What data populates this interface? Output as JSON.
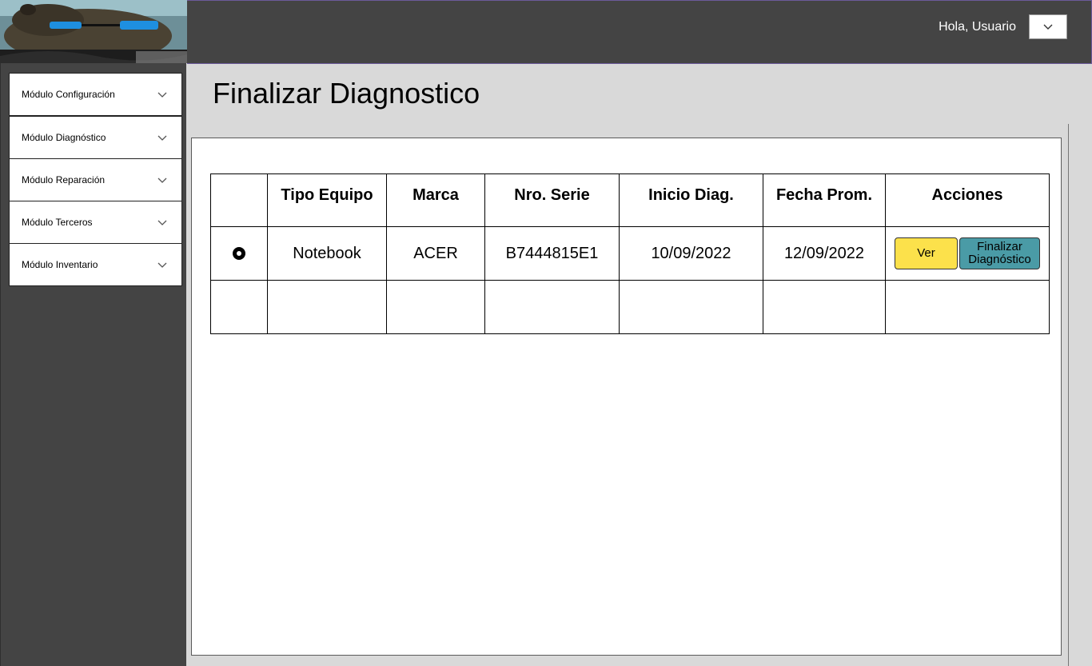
{
  "header": {
    "greeting": "Hola, Usuario",
    "dropdown_icon": "chevron-down-icon"
  },
  "sidebar": {
    "items": [
      {
        "label": "Módulo Configuración"
      },
      {
        "label": "Módulo Diagnóstico"
      },
      {
        "label": "Módulo Reparación"
      },
      {
        "label": "Módulo Terceros"
      },
      {
        "label": "Módulo Inventario"
      }
    ]
  },
  "page": {
    "title": "Finalizar Diagnostico"
  },
  "table": {
    "columns": [
      "",
      "Tipo Equipo",
      "Marca",
      "Nro. Serie",
      "Inicio Diag.",
      "Fecha Prom.",
      "Acciones"
    ],
    "rows": [
      {
        "tipo": "Notebook",
        "marca": "ACER",
        "serie": "B7444815E1",
        "inicio": "10/09/2022",
        "fecha": "12/09/2022",
        "ver_label": "Ver",
        "finalizar_label": "Finalizar\nDiagnóstico"
      }
    ]
  },
  "colors": {
    "header_bg": "#444444",
    "ver_button": "#fce14b",
    "finalizar_button": "#4a9ba6"
  }
}
